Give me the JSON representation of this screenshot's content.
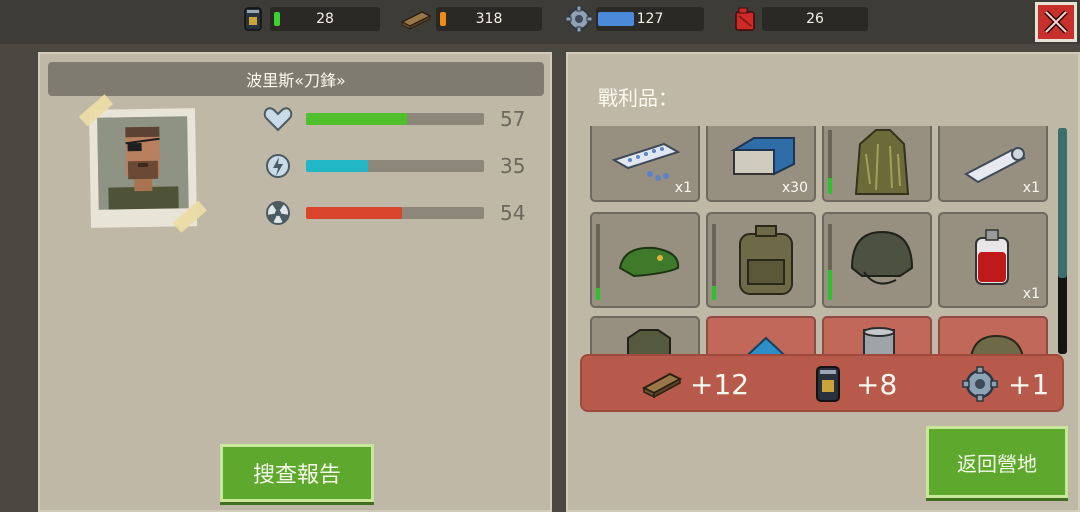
{
  "resources": {
    "fuel_can": {
      "value": "28",
      "icon": "soda-can-icon",
      "pip_color": "#3fd12f"
    },
    "wood": {
      "value": "318",
      "icon": "wood-plank-icon",
      "pip_color": "#f08a1b"
    },
    "gear": {
      "value": "127",
      "icon": "gear-icon",
      "fill_color": "#4a8ad8"
    },
    "gas": {
      "value": "26",
      "icon": "gas-can-icon"
    }
  },
  "character": {
    "name": "波里斯«刀鋒»",
    "stats": [
      {
        "icon": "heart-icon",
        "value": "57",
        "fill": 0.57,
        "color": "#4fbf2c"
      },
      {
        "icon": "energy-icon",
        "value": "35",
        "fill": 0.35,
        "color": "#22b7c6"
      },
      {
        "icon": "radiation-icon",
        "value": "54",
        "fill": 0.54,
        "color": "#d9442d"
      }
    ]
  },
  "buttons": {
    "search_report": "搜查報告",
    "return_camp": "返回營地"
  },
  "loot": {
    "label": "戰利品：",
    "items": [
      {
        "icon": "pill-pack-icon",
        "count": "x1"
      },
      {
        "icon": "plastic-crate-icon",
        "count": "x30"
      },
      {
        "icon": "ghillie-suit-icon",
        "count": ""
      },
      {
        "icon": "fabric-roll-icon",
        "count": "x1"
      },
      {
        "icon": "beret-icon",
        "count": ""
      },
      {
        "icon": "backpack-icon",
        "count": ""
      },
      {
        "icon": "helmet-icon",
        "count": ""
      },
      {
        "icon": "blood-bag-icon",
        "count": "x1"
      },
      {
        "icon": "vest-icon",
        "count": ""
      },
      {
        "icon": "tarp-icon",
        "count": ""
      },
      {
        "icon": "metal-can-icon",
        "count": ""
      },
      {
        "icon": "bag-icon",
        "count": ""
      }
    ]
  },
  "rewards": [
    {
      "icon": "wood-plank-icon",
      "text": "+12"
    },
    {
      "icon": "soda-can-icon",
      "text": "+8"
    },
    {
      "icon": "gear-icon",
      "text": "+1"
    }
  ]
}
